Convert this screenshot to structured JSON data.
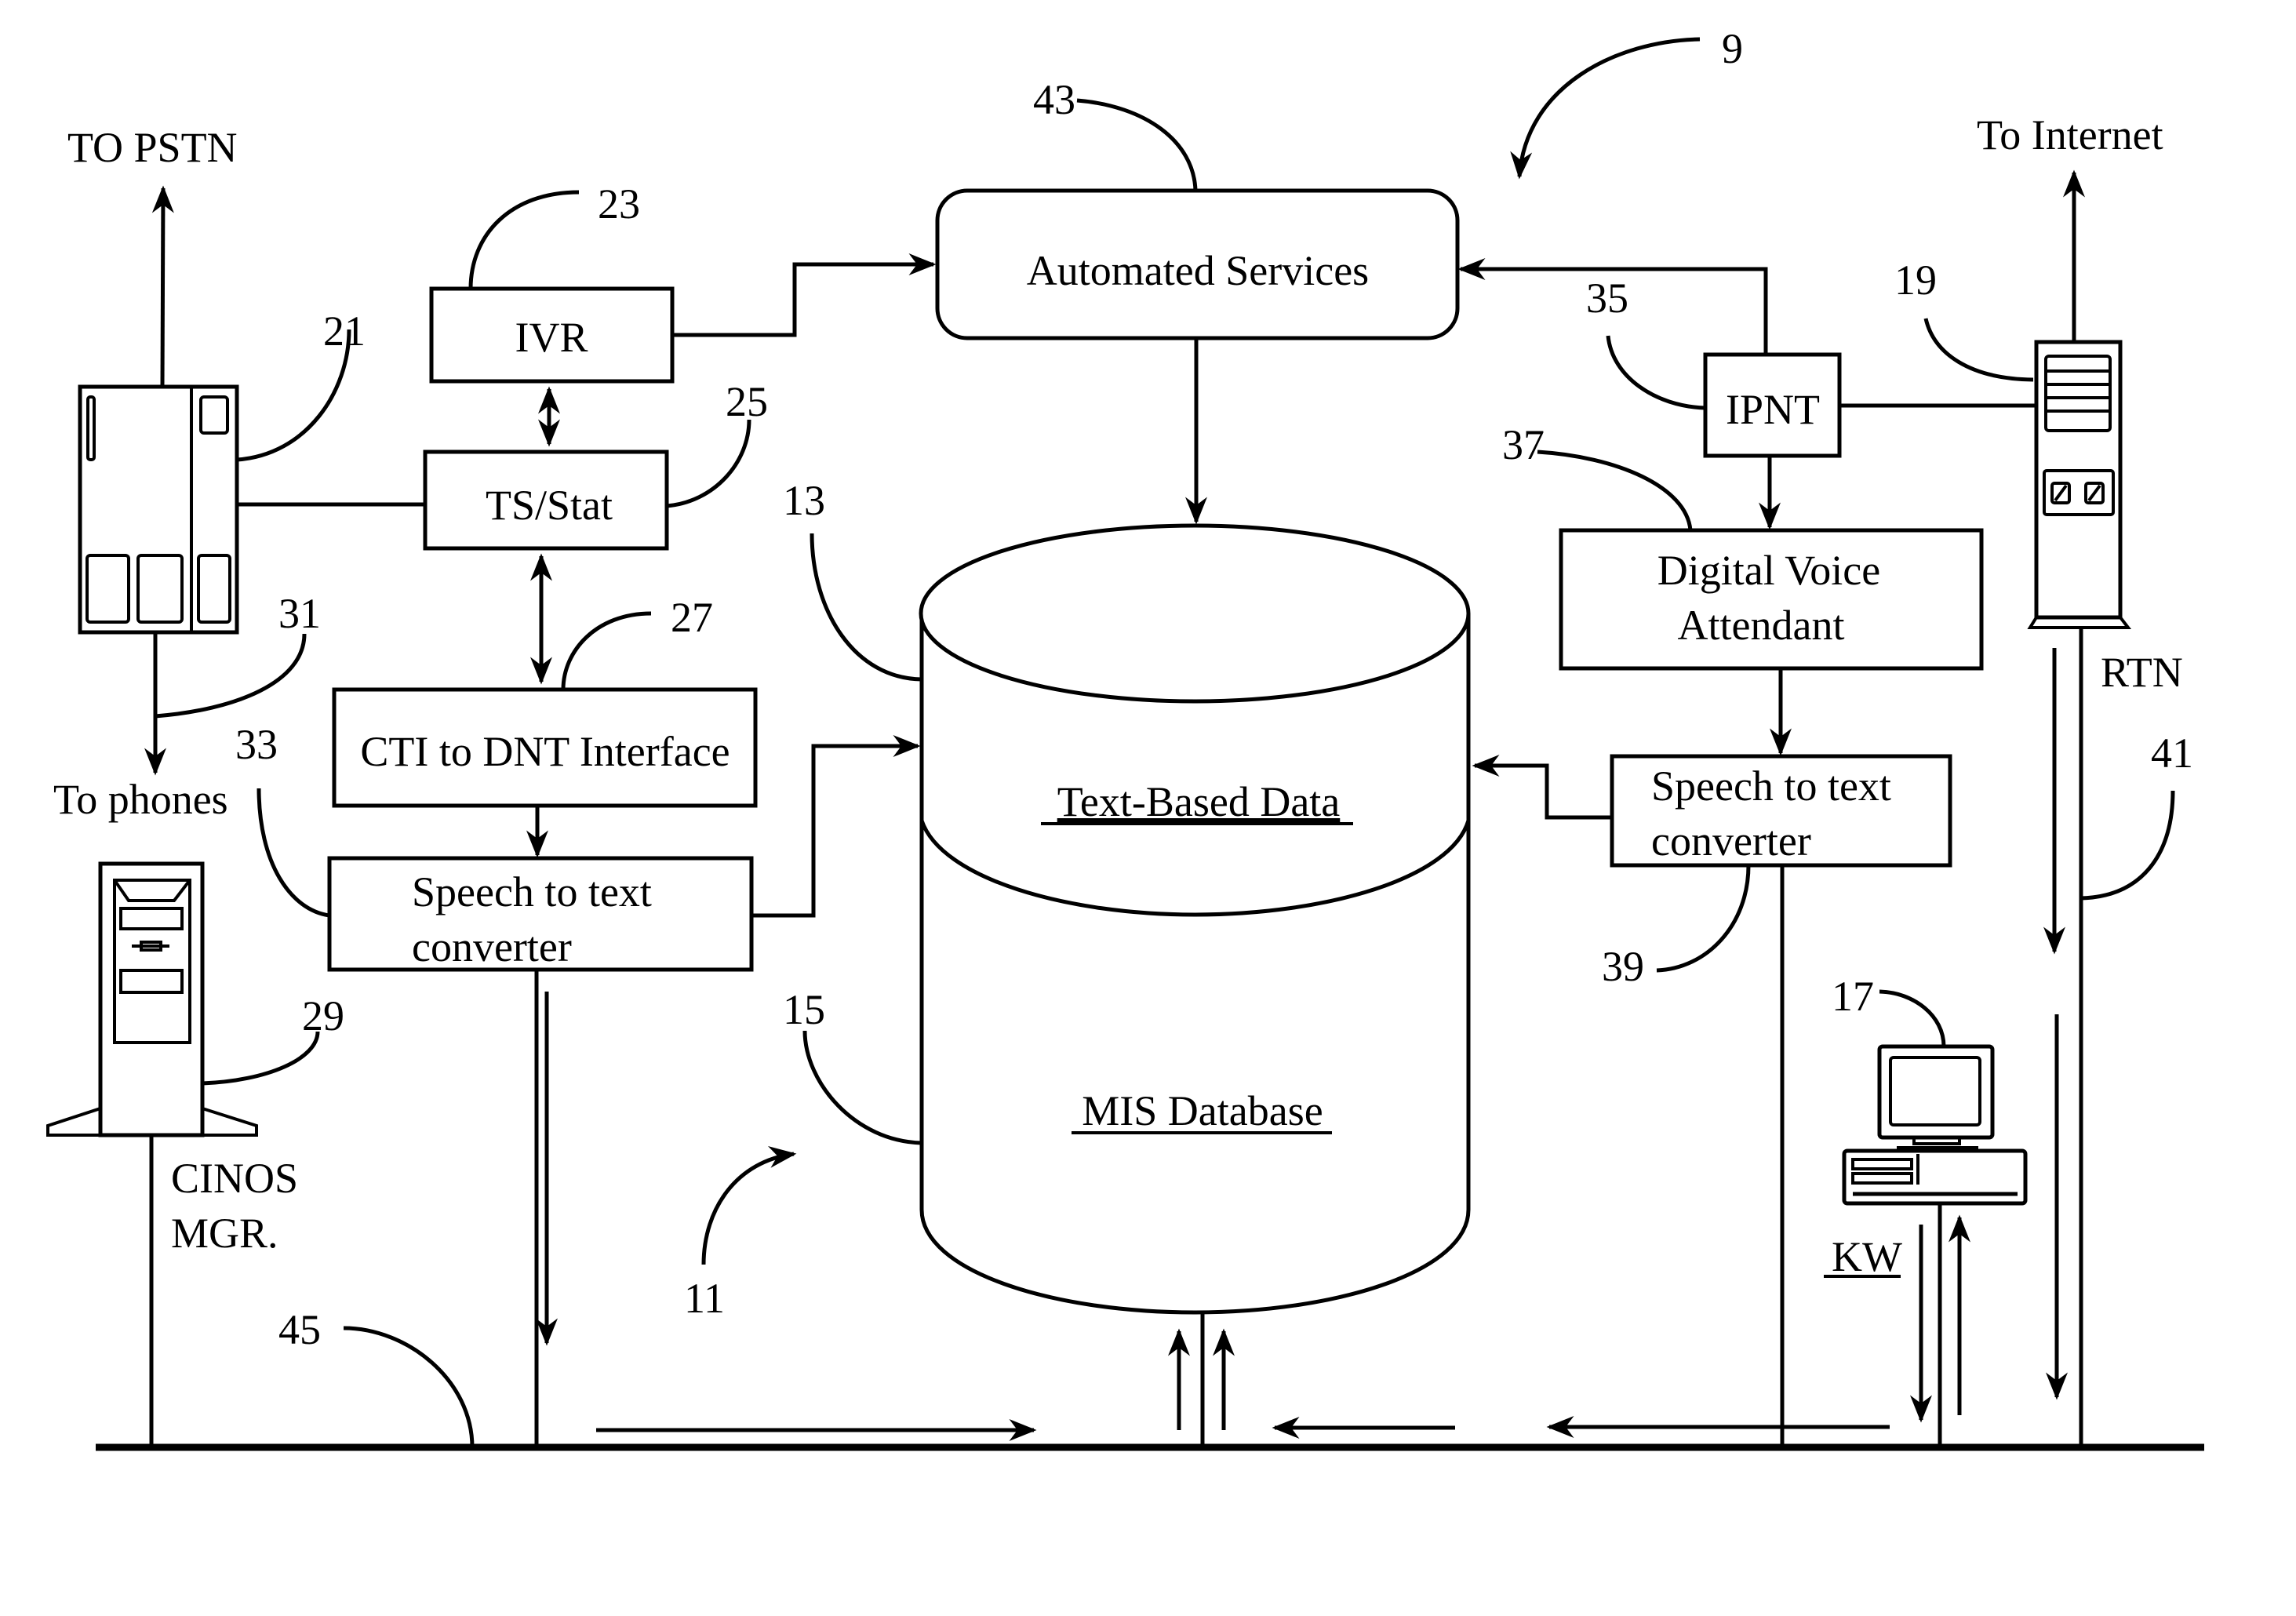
{
  "figure": {
    "system_ref": "9",
    "external": {
      "pstn_label": "TO PSTN",
      "phones_label": "To phones",
      "internet_label": "To Internet"
    },
    "components": {
      "switch": {
        "ref": "21"
      },
      "ivr": {
        "label": "IVR",
        "ref": "23"
      },
      "ts_stat": {
        "label": "TS/Stat",
        "ref": "25"
      },
      "cti": {
        "label": "CTI to DNT Interface",
        "ref": "27"
      },
      "cinos": {
        "label_line1": "CINOS",
        "label_line2": "MGR.",
        "ref": "29"
      },
      "phones_line": {
        "ref": "31"
      },
      "speech_left": {
        "label_line1": "Speech to text",
        "label_line2": "converter",
        "ref": "33"
      },
      "automated_services": {
        "label": "Automated Services",
        "ref": "43"
      },
      "ipnt": {
        "label": "IPNT",
        "ref": "35"
      },
      "dva": {
        "label_line1": "Digital Voice",
        "label_line2": "Attendant",
        "ref": "37"
      },
      "speech_right": {
        "label_line1": "Speech to text",
        "label_line2": "converter",
        "ref": "39"
      },
      "router": {
        "label": "RTN",
        "ref": "19",
        "line_ref": "41"
      },
      "workstation": {
        "label": "KW",
        "ref": "17"
      },
      "database": {
        "top_label": "Text-Based Data",
        "top_ref": "13",
        "bottom_label": "MIS Database",
        "bottom_ref": "15"
      },
      "db_group": {
        "ref": "11"
      },
      "lan": {
        "ref": "45"
      }
    }
  }
}
